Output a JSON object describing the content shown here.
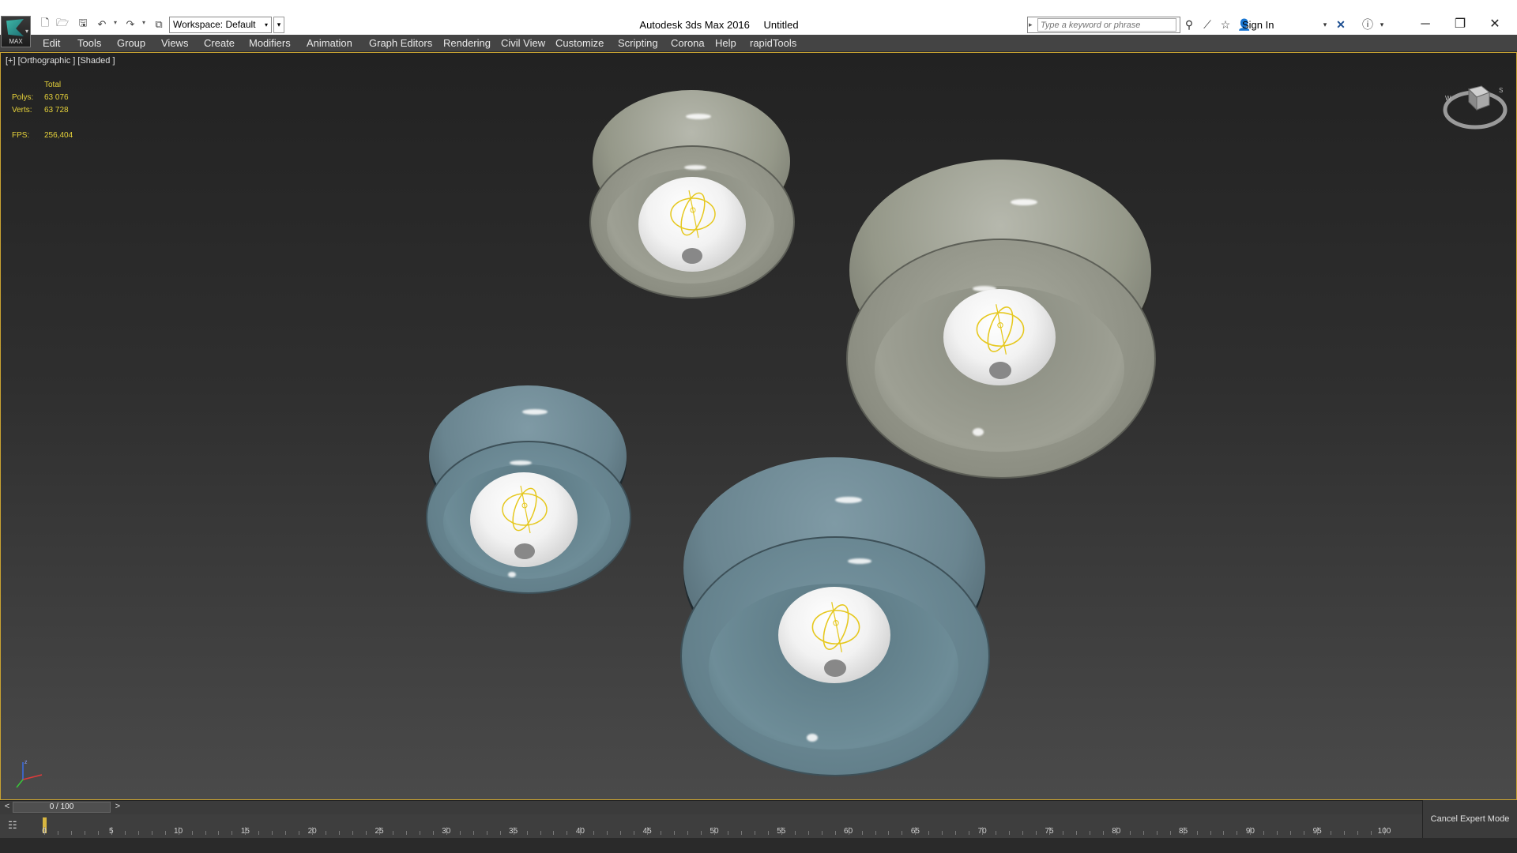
{
  "app": {
    "logo_text": "MAX",
    "title": "Autodesk 3ds Max 2016",
    "document": "Untitled"
  },
  "workspace": {
    "label": "Workspace: Default"
  },
  "search": {
    "placeholder": "Type a keyword or phrase"
  },
  "account": {
    "sign_in": "Sign In"
  },
  "icons": {
    "quick_access": [
      "new-file-icon",
      "open-folder-icon",
      "save-icon",
      "undo-icon",
      "redo-icon",
      "project-folder-icon"
    ],
    "info_center": [
      "binoculars-icon",
      "subscription-icon",
      "star-icon",
      "user-icon",
      "exchange-icon",
      "help-icon"
    ],
    "window": [
      "minimize-icon",
      "restore-icon",
      "close-icon"
    ]
  },
  "menu": {
    "items": [
      "Edit",
      "Tools",
      "Group",
      "Views",
      "Create",
      "Modifiers",
      "Animation",
      "Graph Editors",
      "Rendering",
      "Civil View",
      "Customize",
      "Scripting",
      "Corona",
      "Help",
      "rapidTools"
    ]
  },
  "viewport": {
    "label": "[+] [Orthographic ] [Shaded ]",
    "stats": {
      "header": "Total",
      "polys_label": "Polys:",
      "polys_value": "63 076",
      "verts_label": "Verts:",
      "verts_value": "63 728",
      "fps_label": "FPS:",
      "fps_value": "256,404"
    },
    "colors": {
      "stats_text": "#e6d23a",
      "border": "#c8a232",
      "gizmo": "#e6c81e"
    }
  },
  "timeline": {
    "position": "0 / 100",
    "prev_label": "<",
    "next_label": ">",
    "current_frame": 0,
    "tick_labels": [
      "0",
      "5",
      "10",
      "15",
      "20",
      "25",
      "30",
      "35",
      "40",
      "45",
      "50",
      "55",
      "60",
      "65",
      "70",
      "75",
      "80",
      "85",
      "90",
      "95",
      "100"
    ]
  },
  "status": {
    "cancel_expert_mode": "Cancel Expert Mode"
  }
}
